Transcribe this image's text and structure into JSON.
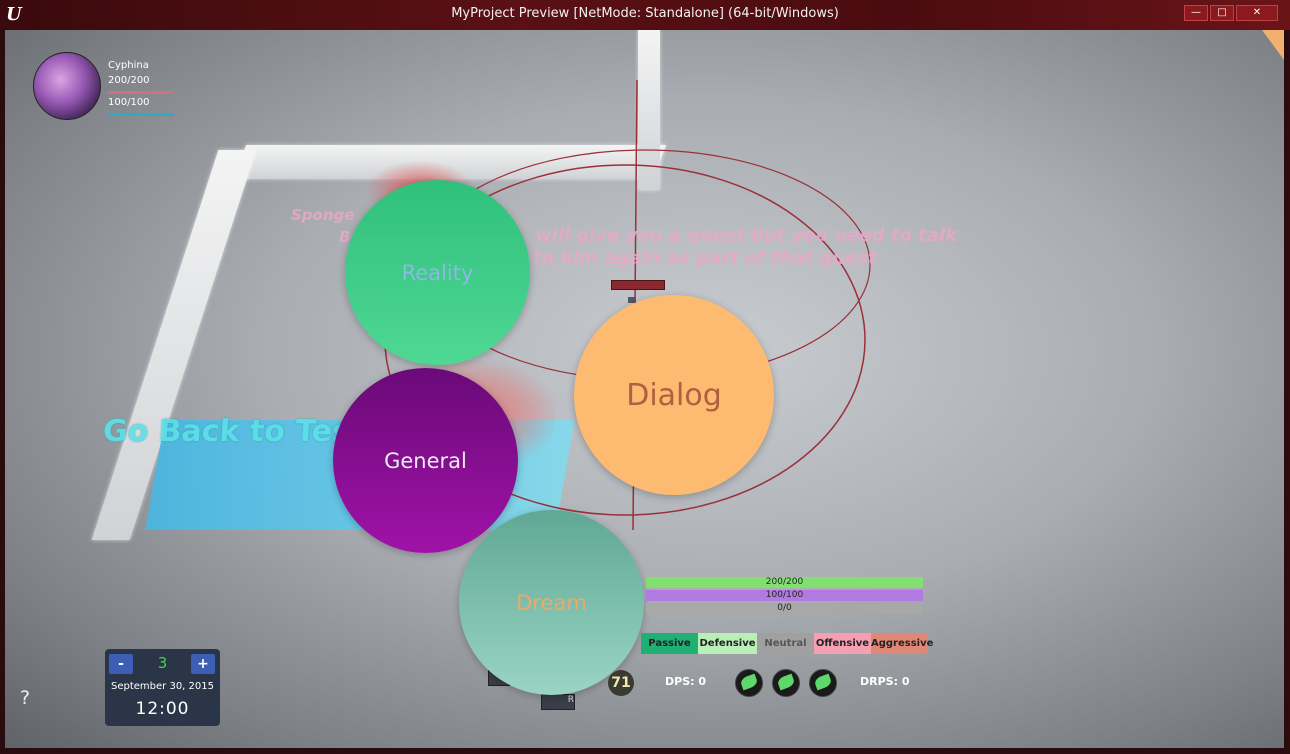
{
  "window": {
    "title": "MyProject Preview [NetMode: Standalone] (64-bit/Windows)",
    "logo": "U",
    "minimize_label": "—",
    "maximize_label": "□",
    "close_label": "✕"
  },
  "world": {
    "sign_line1": "Sponge",
    "sign_line2": "B",
    "quest_line1": "will give you a quest but you need to talk",
    "quest_line2": "to him again as part of that quest",
    "go_back": "Go Back to Tes"
  },
  "radial_menu": {
    "reality": "Reality",
    "general": "General",
    "dialog": "Dialog",
    "dream": "Dream"
  },
  "player": {
    "name": "Cyphina",
    "hp": "200/200",
    "mp": "100/100"
  },
  "clock": {
    "minus_label": "-",
    "plus_label": "+",
    "day": "3",
    "date": "September 30, 2015",
    "time": "12:00"
  },
  "help_label": "?",
  "stats": {
    "hp": "200/200",
    "mp": "100/100",
    "xp": "0/0",
    "hp_fraction": 1.0,
    "mp_fraction": 1.0,
    "xp_fraction": 0.0
  },
  "stances": [
    "Passive",
    "Defensive",
    "Neutral",
    "Offensive",
    "Aggressive"
  ],
  "combat": {
    "dps": "DPS: 0",
    "drps": "DRPS: 0",
    "level": "71",
    "skill_key": "R"
  },
  "colors": {
    "reality": "#3ac988",
    "general": "#8a0e96",
    "dialog": "#fdbb72",
    "dream": "#7dbcab"
  }
}
